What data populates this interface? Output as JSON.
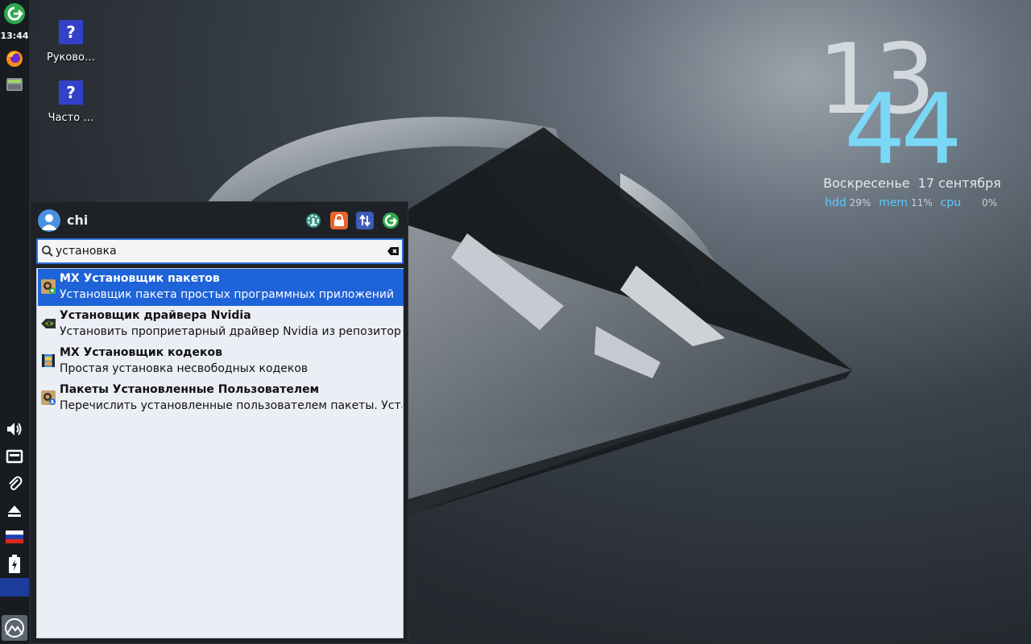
{
  "panel": {
    "clock": "13:44",
    "items": [
      {
        "name": "logout-icon"
      },
      {
        "name": "firefox-icon"
      },
      {
        "name": "file-manager-icon"
      },
      {
        "name": "volume-icon"
      },
      {
        "name": "network-icon"
      },
      {
        "name": "clipboard-icon"
      },
      {
        "name": "eject-icon"
      },
      {
        "name": "keyboard-layout-flag-icon"
      },
      {
        "name": "battery-icon"
      },
      {
        "name": "mx-menu-icon"
      }
    ]
  },
  "desktop": {
    "icons": [
      {
        "label": "Руково…",
        "glyph": "?"
      },
      {
        "label": "Часто …",
        "glyph": "?"
      }
    ]
  },
  "conky": {
    "hour": "13",
    "minute": "44",
    "weekday": "Воскресенье",
    "date": "17 сентября",
    "stats": [
      {
        "key": "hdd",
        "value": "29%"
      },
      {
        "key": "mem",
        "value": "11%"
      },
      {
        "key": "cpu",
        "value": "0%"
      }
    ],
    "colors": {
      "hour": "#d8dde2",
      "minute": "#7ad7f5",
      "stat_key": "#5bc8ff"
    }
  },
  "menu": {
    "username": "chi",
    "header_buttons": [
      {
        "name": "settings-manager-icon",
        "color": "#2f8f83"
      },
      {
        "name": "lock-screen-icon",
        "color": "#e8632b"
      },
      {
        "name": "switch-user-icon",
        "color": "#3d5cb8"
      },
      {
        "name": "logout-icon",
        "color": "#2fa84f"
      }
    ],
    "search": {
      "value": "установка",
      "placeholder": ""
    },
    "results": [
      {
        "title": "MX Установщик пакетов",
        "description": "Установщик пакета простых программных приложений",
        "icon": "package-installer-icon",
        "selected": true
      },
      {
        "title": "Установщик драйвера Nvidia",
        "description": "Установить проприетарный драйвер Nvidia из репозитория",
        "icon": "nvidia-icon",
        "selected": false
      },
      {
        "title": "MX Установщик кодеков",
        "description": "Простая установка несвободных кодеков",
        "icon": "codecs-icon",
        "selected": false
      },
      {
        "title": "Пакеты Установленные Пользователем",
        "description": "Перечислить установленные пользователем пакеты. Устан…",
        "icon": "user-packages-icon",
        "selected": false
      }
    ],
    "accent": "#1e63d8"
  }
}
